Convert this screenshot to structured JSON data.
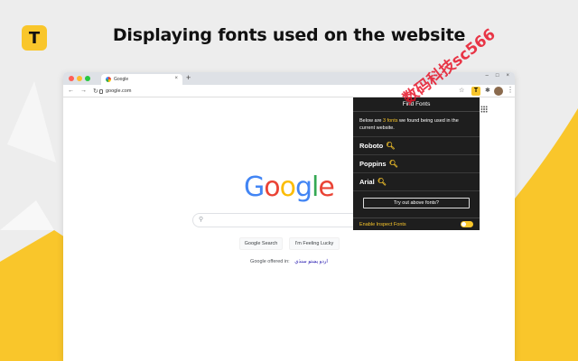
{
  "brand": {
    "logo_letter": "T",
    "accent": "#f9c62b"
  },
  "headline": "Displaying fonts used on the website",
  "browser": {
    "tab_title": "Google",
    "tab_close": "×",
    "new_tab": "+",
    "url": "google.com",
    "window_controls": [
      "–",
      "□",
      "×"
    ],
    "nav": {
      "back": "←",
      "forward": "→",
      "reload": "↻"
    },
    "star": "☆",
    "ext_letter": "T",
    "menu": "⋮"
  },
  "google": {
    "logo_letters": [
      {
        "ch": "G",
        "color": "#4285f4"
      },
      {
        "ch": "o",
        "color": "#ea4335"
      },
      {
        "ch": "o",
        "color": "#fbbc05"
      },
      {
        "ch": "g",
        "color": "#4285f4"
      },
      {
        "ch": "l",
        "color": "#34a853"
      },
      {
        "ch": "e",
        "color": "#ea4335"
      }
    ],
    "search_button": "Google Search",
    "lucky_button": "I'm Feeling Lucky",
    "offered_in": "Google offered in:",
    "languages": "اردو  پښتو  سنڌي"
  },
  "popup": {
    "title": "Find Fonts",
    "desc_before": "Below are ",
    "desc_count": "3 fonts",
    "desc_after": " we found being used in the current website.",
    "fonts": [
      "Roboto",
      "Poppins",
      "Arial"
    ],
    "try_button": "Try out above fonts?",
    "inspect_label": "Enable Inspect Fonts",
    "inspect_enabled": true
  },
  "watermark": "数码科技sc566"
}
